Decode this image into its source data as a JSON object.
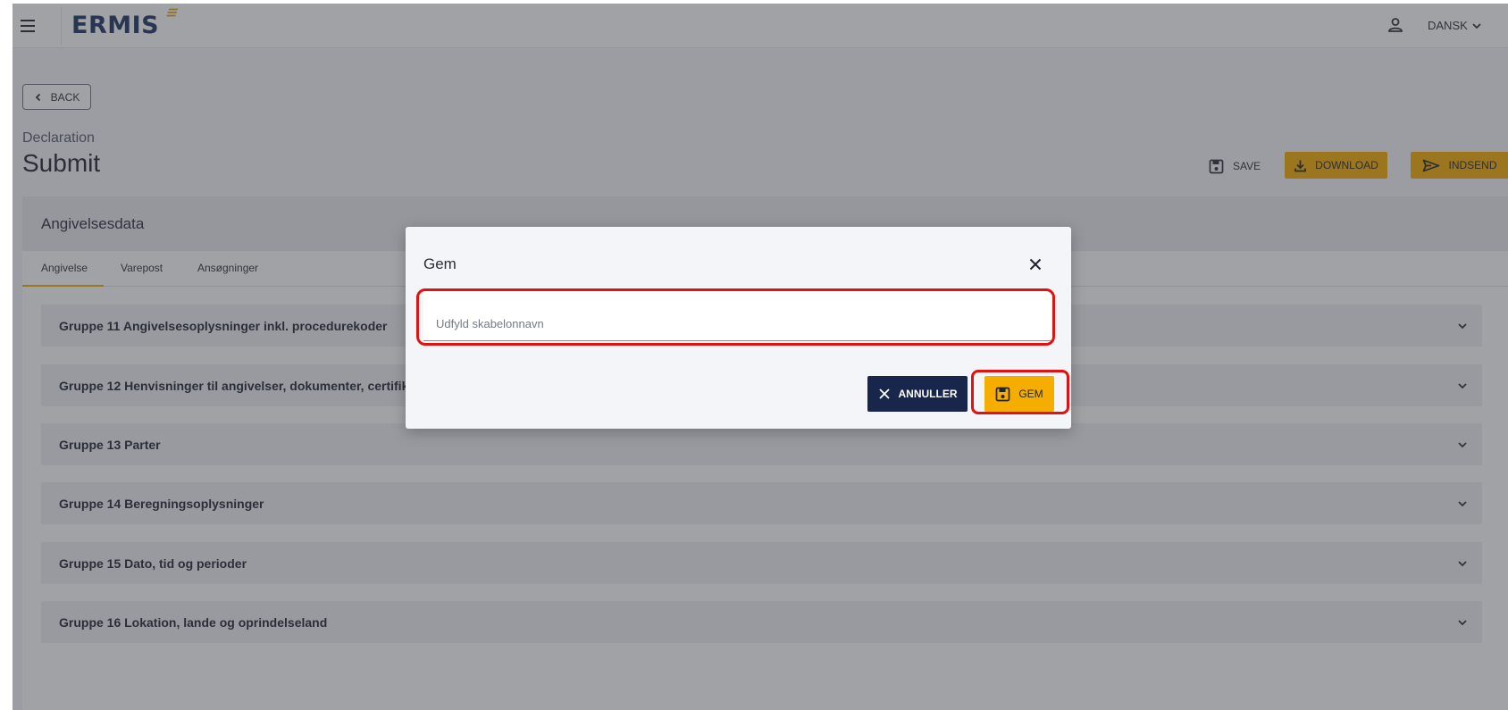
{
  "header": {
    "logo_text": "ERMIS",
    "language": "DANSK"
  },
  "page": {
    "back_label": "BACK",
    "subtitle": "Declaration",
    "title": "Submit",
    "actions": {
      "save": "SAVE",
      "download": "DOWNLOAD",
      "send": "INDSEND"
    }
  },
  "panel": {
    "title": "Angivelsesdata",
    "tabs": [
      "Angivelse",
      "Varepost",
      "Ansøgninger"
    ],
    "groups": [
      "Gruppe 11 Angivelsesoplysninger inkl. procedurekoder",
      "Gruppe 12 Henvisninger til angivelser, dokumenter, certifikater og tilladelser",
      "Gruppe 13 Parter",
      "Gruppe 14 Beregningsoplysninger",
      "Gruppe 15 Dato, tid og perioder",
      "Gruppe 16 Lokation, lande og oprindelseland"
    ]
  },
  "dialog": {
    "title": "Gem",
    "input_placeholder": "Udfyld skabelonnavn",
    "input_value": "",
    "cancel_label": "ANNULLER",
    "confirm_label": "GEM"
  },
  "colors": {
    "accent": "#f5ad00",
    "primary_dark": "#17264a",
    "highlight": "#e41010"
  }
}
